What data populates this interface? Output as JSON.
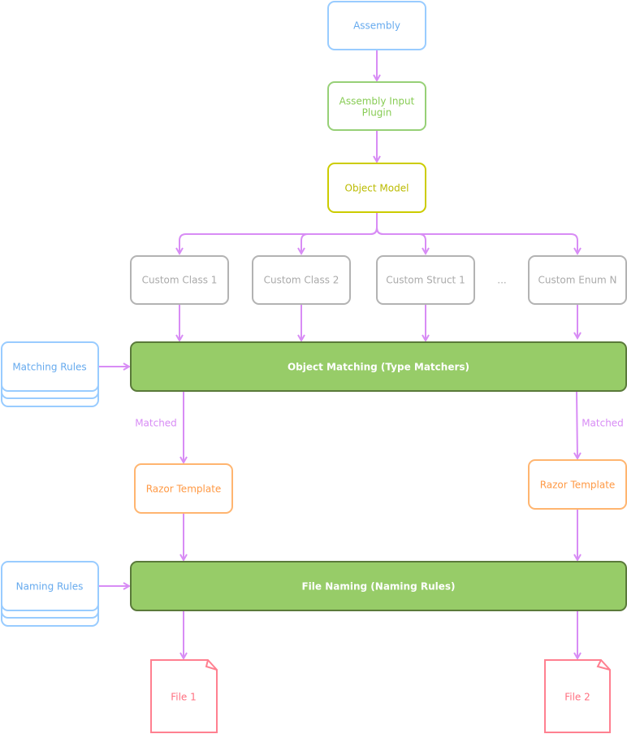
{
  "colors": {
    "edge": "#d88cf5",
    "blue": "#99ccff",
    "green": "#97d077",
    "darkgreen": "#5a7a3a",
    "yellow": "#cccc00",
    "gray": "#b3b3b3",
    "orange": "#ffb570",
    "red": "#ff8090"
  },
  "nodes": {
    "assembly": "Assembly",
    "input_plugin_1": "Assembly Input",
    "input_plugin_2": "Plugin",
    "object_model": "Object Model",
    "custom_class_1": "Custom Class 1",
    "custom_class_2": "Custom Class 2",
    "custom_struct_1": "Custom Struct 1",
    "ellipsis": "...",
    "custom_enum_n": "Custom Enum N",
    "matching_rules": "Matching Rules",
    "object_matching": "Object Matching (Type Matchers)",
    "razor_left": "Razor Template",
    "razor_right": "Razor Template",
    "naming_rules": "Naming Rules",
    "file_naming": "File Naming (Naming Rules)",
    "file_1": "File 1",
    "file_2": "File 2"
  },
  "edge_labels": {
    "matched_left": "Matched",
    "matched_right": "Matched"
  }
}
